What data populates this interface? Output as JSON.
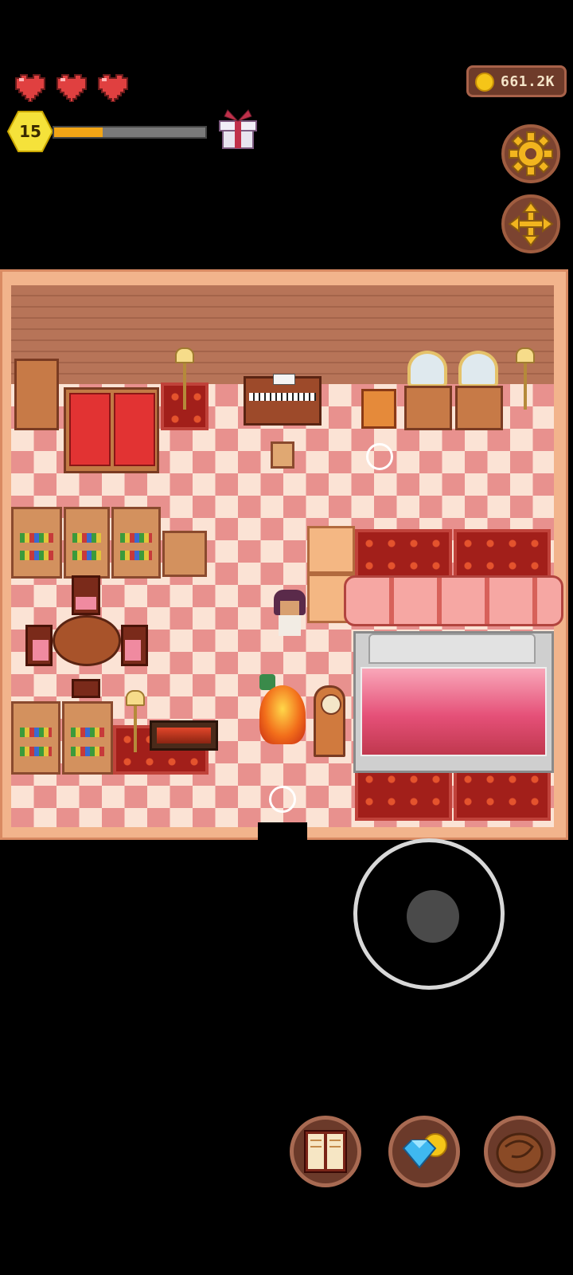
{
  "hud": {
    "hearts": [
      "heart-full",
      "heart-full",
      "heart-full"
    ],
    "level": "15",
    "xp_progress": 0.32,
    "coins": "661.2K",
    "gift_icon": "gift-icon",
    "settings_icon": "gear-icon",
    "move_icon": "move-arrows-icon"
  },
  "bottom_bar": {
    "items": [
      {
        "name": "journal",
        "icon": "book-icon"
      },
      {
        "name": "shop",
        "icon": "gem-coin-icon"
      },
      {
        "name": "inventory",
        "icon": "leather-bag-icon"
      }
    ]
  },
  "colors": {
    "xp_fill": "#f2a516",
    "level_badge": "#f5e23a",
    "coin_bg": "#6e3b2a",
    "button_bg": "#7b4330",
    "gear": "#f2b51e"
  }
}
